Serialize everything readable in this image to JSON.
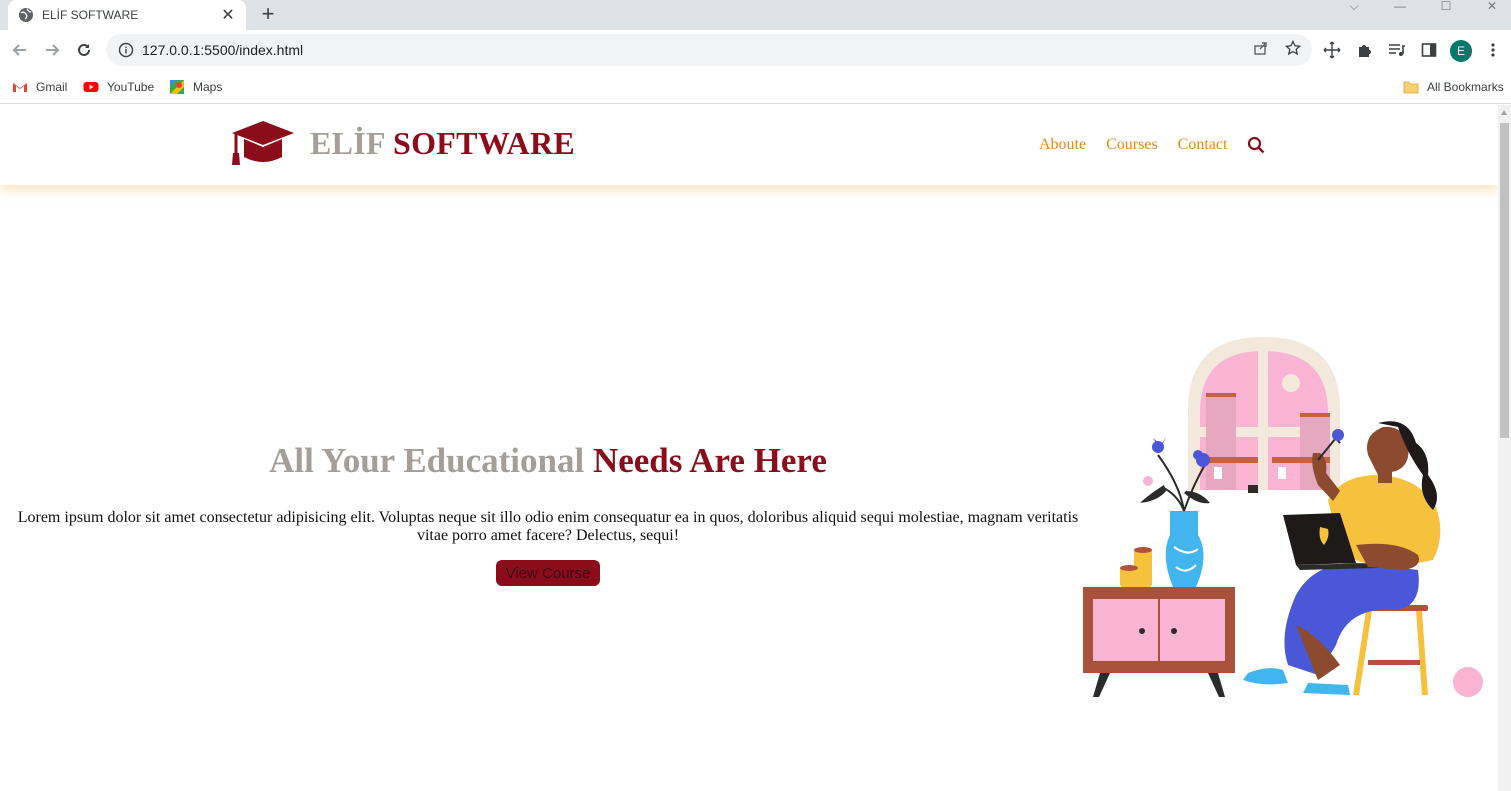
{
  "browser": {
    "tab_title": "ELİF SOFTWARE",
    "url": "127.0.0.1:5500/index.html",
    "profile_initial": "E",
    "bookmarks": [
      {
        "label": "Gmail",
        "icon": "gmail-icon"
      },
      {
        "label": "YouTube",
        "icon": "youtube-icon"
      },
      {
        "label": "Maps",
        "icon": "maps-icon"
      }
    ],
    "all_bookmarks": "All Bookmarks"
  },
  "site": {
    "brand_part1": "ELİF",
    "brand_part2": "SOFTWARE",
    "nav": [
      "Aboute",
      "Courses",
      "Contact"
    ],
    "hero_title_part1": "All Your Educational",
    "hero_title_part2": "Needs Are Here",
    "hero_text": "Lorem ipsum dolor sit amet consectetur adipisicing elit. Voluptas neque sit illo odio enim consequatur ea in quos, doloribus aliquid sequi molestiae, magnam veritatis vitae porro amet facere? Delectus, sequi!",
    "cta_label": "View Course"
  },
  "colors": {
    "brand_gray": "#a39e97",
    "brand_maroon": "#8b0d1c",
    "nav_orange": "#e08a1a"
  }
}
